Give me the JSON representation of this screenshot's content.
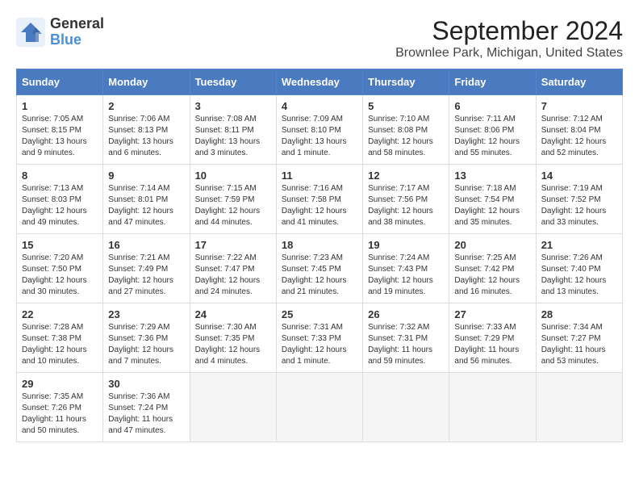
{
  "header": {
    "logo_line1": "General",
    "logo_line2": "Blue",
    "title": "September 2024",
    "subtitle": "Brownlee Park, Michigan, United States"
  },
  "weekdays": [
    "Sunday",
    "Monday",
    "Tuesday",
    "Wednesday",
    "Thursday",
    "Friday",
    "Saturday"
  ],
  "weeks": [
    [
      {
        "day": "1",
        "info": "Sunrise: 7:05 AM\nSunset: 8:15 PM\nDaylight: 13 hours\nand 9 minutes."
      },
      {
        "day": "2",
        "info": "Sunrise: 7:06 AM\nSunset: 8:13 PM\nDaylight: 13 hours\nand 6 minutes."
      },
      {
        "day": "3",
        "info": "Sunrise: 7:08 AM\nSunset: 8:11 PM\nDaylight: 13 hours\nand 3 minutes."
      },
      {
        "day": "4",
        "info": "Sunrise: 7:09 AM\nSunset: 8:10 PM\nDaylight: 13 hours\nand 1 minute."
      },
      {
        "day": "5",
        "info": "Sunrise: 7:10 AM\nSunset: 8:08 PM\nDaylight: 12 hours\nand 58 minutes."
      },
      {
        "day": "6",
        "info": "Sunrise: 7:11 AM\nSunset: 8:06 PM\nDaylight: 12 hours\nand 55 minutes."
      },
      {
        "day": "7",
        "info": "Sunrise: 7:12 AM\nSunset: 8:04 PM\nDaylight: 12 hours\nand 52 minutes."
      }
    ],
    [
      {
        "day": "8",
        "info": "Sunrise: 7:13 AM\nSunset: 8:03 PM\nDaylight: 12 hours\nand 49 minutes."
      },
      {
        "day": "9",
        "info": "Sunrise: 7:14 AM\nSunset: 8:01 PM\nDaylight: 12 hours\nand 47 minutes."
      },
      {
        "day": "10",
        "info": "Sunrise: 7:15 AM\nSunset: 7:59 PM\nDaylight: 12 hours\nand 44 minutes."
      },
      {
        "day": "11",
        "info": "Sunrise: 7:16 AM\nSunset: 7:58 PM\nDaylight: 12 hours\nand 41 minutes."
      },
      {
        "day": "12",
        "info": "Sunrise: 7:17 AM\nSunset: 7:56 PM\nDaylight: 12 hours\nand 38 minutes."
      },
      {
        "day": "13",
        "info": "Sunrise: 7:18 AM\nSunset: 7:54 PM\nDaylight: 12 hours\nand 35 minutes."
      },
      {
        "day": "14",
        "info": "Sunrise: 7:19 AM\nSunset: 7:52 PM\nDaylight: 12 hours\nand 33 minutes."
      }
    ],
    [
      {
        "day": "15",
        "info": "Sunrise: 7:20 AM\nSunset: 7:50 PM\nDaylight: 12 hours\nand 30 minutes."
      },
      {
        "day": "16",
        "info": "Sunrise: 7:21 AM\nSunset: 7:49 PM\nDaylight: 12 hours\nand 27 minutes."
      },
      {
        "day": "17",
        "info": "Sunrise: 7:22 AM\nSunset: 7:47 PM\nDaylight: 12 hours\nand 24 minutes."
      },
      {
        "day": "18",
        "info": "Sunrise: 7:23 AM\nSunset: 7:45 PM\nDaylight: 12 hours\nand 21 minutes."
      },
      {
        "day": "19",
        "info": "Sunrise: 7:24 AM\nSunset: 7:43 PM\nDaylight: 12 hours\nand 19 minutes."
      },
      {
        "day": "20",
        "info": "Sunrise: 7:25 AM\nSunset: 7:42 PM\nDaylight: 12 hours\nand 16 minutes."
      },
      {
        "day": "21",
        "info": "Sunrise: 7:26 AM\nSunset: 7:40 PM\nDaylight: 12 hours\nand 13 minutes."
      }
    ],
    [
      {
        "day": "22",
        "info": "Sunrise: 7:28 AM\nSunset: 7:38 PM\nDaylight: 12 hours\nand 10 minutes."
      },
      {
        "day": "23",
        "info": "Sunrise: 7:29 AM\nSunset: 7:36 PM\nDaylight: 12 hours\nand 7 minutes."
      },
      {
        "day": "24",
        "info": "Sunrise: 7:30 AM\nSunset: 7:35 PM\nDaylight: 12 hours\nand 4 minutes."
      },
      {
        "day": "25",
        "info": "Sunrise: 7:31 AM\nSunset: 7:33 PM\nDaylight: 12 hours\nand 1 minute."
      },
      {
        "day": "26",
        "info": "Sunrise: 7:32 AM\nSunset: 7:31 PM\nDaylight: 11 hours\nand 59 minutes."
      },
      {
        "day": "27",
        "info": "Sunrise: 7:33 AM\nSunset: 7:29 PM\nDaylight: 11 hours\nand 56 minutes."
      },
      {
        "day": "28",
        "info": "Sunrise: 7:34 AM\nSunset: 7:27 PM\nDaylight: 11 hours\nand 53 minutes."
      }
    ],
    [
      {
        "day": "29",
        "info": "Sunrise: 7:35 AM\nSunset: 7:26 PM\nDaylight: 11 hours\nand 50 minutes."
      },
      {
        "day": "30",
        "info": "Sunrise: 7:36 AM\nSunset: 7:24 PM\nDaylight: 11 hours\nand 47 minutes."
      },
      {
        "day": "",
        "info": ""
      },
      {
        "day": "",
        "info": ""
      },
      {
        "day": "",
        "info": ""
      },
      {
        "day": "",
        "info": ""
      },
      {
        "day": "",
        "info": ""
      }
    ]
  ]
}
